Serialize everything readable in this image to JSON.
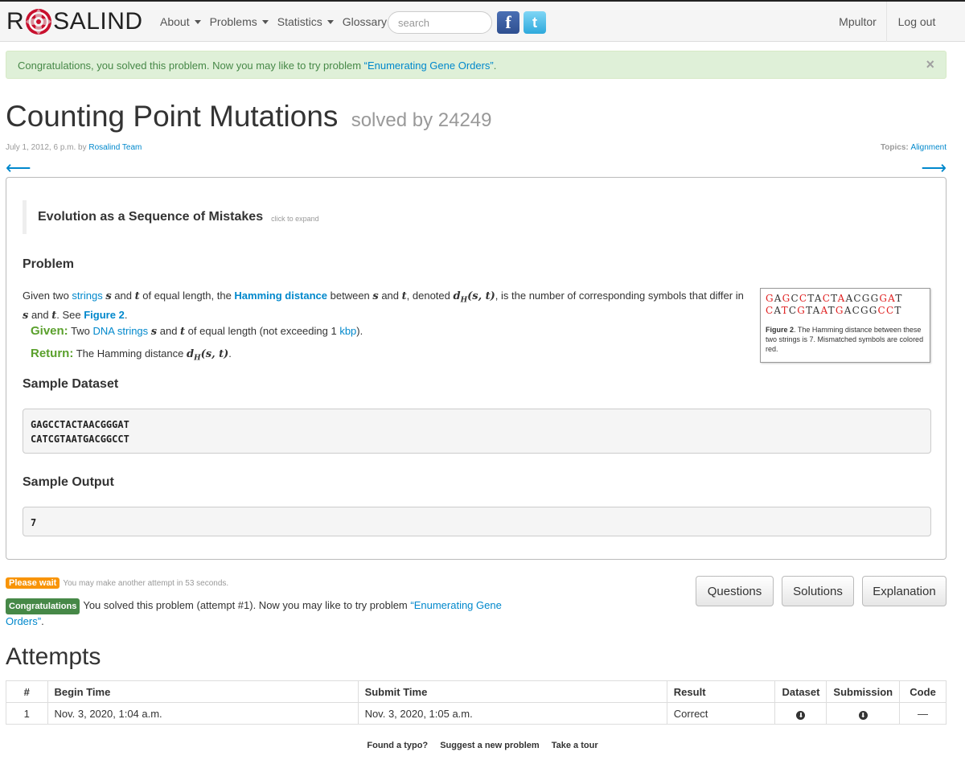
{
  "nav": {
    "brand_left": "R",
    "brand_right": "SALIND",
    "items": [
      {
        "label": "About",
        "caret": true
      },
      {
        "label": "Problems",
        "caret": true
      },
      {
        "label": "Statistics",
        "caret": true
      },
      {
        "label": "Glossary",
        "caret": false
      }
    ],
    "search_placeholder": "search",
    "facebook_glyph": "f",
    "twitter_glyph": "t",
    "user": "Mpultor",
    "logout": "Log out"
  },
  "alert": {
    "text": "Congratulations, you solved this problem. Now you may like to try problem ",
    "link": "“Enumerating Gene Orders”",
    "end": ".",
    "close": "×"
  },
  "problem": {
    "title": "Counting Point Mutations",
    "solved": "solved by 24249",
    "date": "July 1, 2012, 6 p.m. by ",
    "author": "Rosalind Team",
    "topics_label": "Topics: ",
    "topics": "Alignment",
    "prev_arrow": "⟵",
    "next_arrow": "⟶",
    "background_title": "Evolution as a Sequence of Mistakes",
    "expand_hint": "click to expand",
    "section_problem": "Problem",
    "section_sample_dataset": "Sample Dataset",
    "section_sample_output": "Sample Output",
    "given_label": "Given:",
    "return_label": "Return:",
    "sample_dataset": [
      "GAGCCTACTAACGGGAT",
      "CATCGTAATGACGGCCT"
    ],
    "sample_output": "7"
  },
  "figure": {
    "seq1": [
      {
        "c": "G",
        "m": true
      },
      {
        "c": "A",
        "m": false
      },
      {
        "c": "G",
        "m": true
      },
      {
        "c": "C",
        "m": false
      },
      {
        "c": "C",
        "m": true
      },
      {
        "c": "T",
        "m": false
      },
      {
        "c": "A",
        "m": false
      },
      {
        "c": "C",
        "m": true
      },
      {
        "c": "T",
        "m": false
      },
      {
        "c": "A",
        "m": true
      },
      {
        "c": "A",
        "m": false
      },
      {
        "c": "C",
        "m": false
      },
      {
        "c": "G",
        "m": false
      },
      {
        "c": "G",
        "m": false
      },
      {
        "c": "G",
        "m": true
      },
      {
        "c": "A",
        "m": true
      },
      {
        "c": "T",
        "m": false
      }
    ],
    "seq2": [
      {
        "c": "C",
        "m": true
      },
      {
        "c": "A",
        "m": false
      },
      {
        "c": "T",
        "m": true
      },
      {
        "c": "C",
        "m": false
      },
      {
        "c": "G",
        "m": true
      },
      {
        "c": "T",
        "m": false
      },
      {
        "c": "A",
        "m": false
      },
      {
        "c": "A",
        "m": true
      },
      {
        "c": "T",
        "m": false
      },
      {
        "c": "G",
        "m": true
      },
      {
        "c": "A",
        "m": false
      },
      {
        "c": "C",
        "m": false
      },
      {
        "c": "G",
        "m": false
      },
      {
        "c": "G",
        "m": false
      },
      {
        "c": "C",
        "m": true
      },
      {
        "c": "C",
        "m": true
      },
      {
        "c": "T",
        "m": false
      }
    ],
    "caption_label": "Figure 2",
    "caption": ". The Hamming distance between these two strings is 7. Mismatched symbols are colored red."
  },
  "status": {
    "wait_badge": "Please wait",
    "wait_text": "You may make another attempt in 53 seconds.",
    "congrats_badge": "Congratulations",
    "congrats_text": "You solved this problem (attempt #1). Now you may like to try problem ",
    "congrats_link": "“Enumerating Gene Orders”",
    "congrats_end": ".",
    "buttons": [
      "Questions",
      "Solutions",
      "Explanation"
    ]
  },
  "attempts": {
    "heading": "Attempts",
    "columns": [
      "#",
      "Begin Time",
      "Submit Time",
      "Result",
      "Dataset",
      "Submission",
      "Code"
    ],
    "rows": [
      {
        "num": "1",
        "begin": "Nov. 3, 2020, 1:04 a.m.",
        "submit": "Nov. 3, 2020, 1:05 a.m.",
        "result": "Correct",
        "dataset_icon": "download-icon",
        "submission_icon": "download-icon",
        "code": "—"
      }
    ]
  },
  "footer": [
    "Found a typo?",
    "Suggest a new problem",
    "Take a tour"
  ]
}
